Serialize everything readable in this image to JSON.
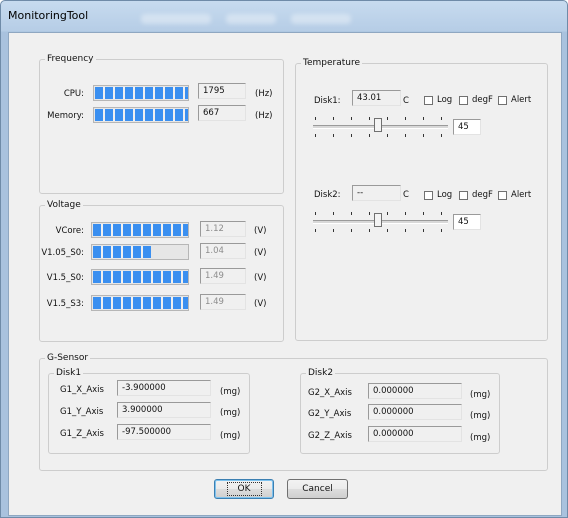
{
  "window": {
    "title": "MonitoringTool"
  },
  "frequency": {
    "title": "Frequency",
    "rows": [
      {
        "label": "CPU:",
        "value": "1795",
        "unit": "(Hz)",
        "level": 1.0
      },
      {
        "label": "Memory:",
        "value": "667",
        "unit": "(Hz)",
        "level": 1.0
      }
    ]
  },
  "voltage": {
    "title": "Voltage",
    "rows": [
      {
        "label": "VCore:",
        "value": "1.12",
        "unit": "(V)",
        "level": 1.0
      },
      {
        "label": "V1.05_S0:",
        "value": "1.04",
        "unit": "(V)",
        "level": 0.6
      },
      {
        "label": "V1.5_S0:",
        "value": "1.49",
        "unit": "(V)",
        "level": 1.0
      },
      {
        "label": "V1.5_S3:",
        "value": "1.49",
        "unit": "(V)",
        "level": 1.0
      }
    ]
  },
  "temperature": {
    "title": "Temperature",
    "disks": [
      {
        "label": "Disk1:",
        "value": "43.01",
        "unit": "C",
        "log": "Log",
        "degf": "degF",
        "alert": "Alert",
        "slider_value": "45"
      },
      {
        "label": "Disk2:",
        "value": "--",
        "unit": "C",
        "log": "Log",
        "degf": "degF",
        "alert": "Alert",
        "slider_value": "45"
      }
    ]
  },
  "gsensor": {
    "title": "G-Sensor",
    "disk1": {
      "title": "Disk1",
      "rows": [
        {
          "label": "G1_X_Axis",
          "value": "-3.900000",
          "unit": "(mg)"
        },
        {
          "label": "G1_Y_Axis",
          "value": "3.900000",
          "unit": "(mg)"
        },
        {
          "label": "G1_Z_Axis",
          "value": "-97.500000",
          "unit": "(mg)"
        }
      ]
    },
    "disk2": {
      "title": "Disk2",
      "rows": [
        {
          "label": "G2_X_Axis",
          "value": "0.000000",
          "unit": "(mg)"
        },
        {
          "label": "G2_Y_Axis",
          "value": "0.000000",
          "unit": "(mg)"
        },
        {
          "label": "G2_Z_Axis",
          "value": "0.000000",
          "unit": "(mg)"
        }
      ]
    }
  },
  "buttons": {
    "ok": "OK",
    "cancel": "Cancel"
  },
  "colors": {
    "progress_fill": "#3a8ff0",
    "title_bar": "#b9cfe7"
  }
}
